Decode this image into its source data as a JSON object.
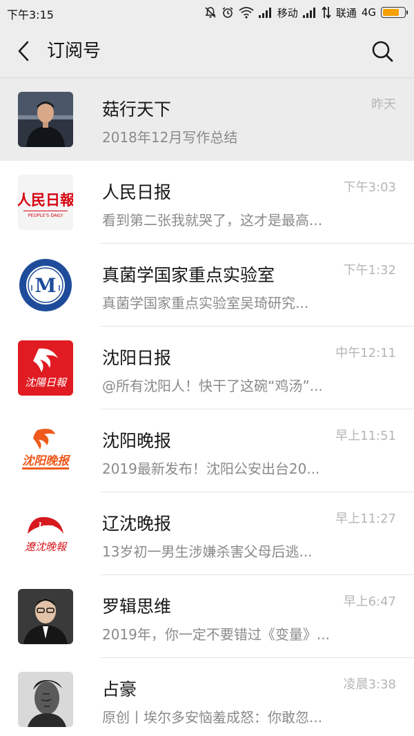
{
  "status_bar": {
    "time": "下午3:15",
    "carrier1": "移动",
    "carrier2": "联通",
    "network": "4G",
    "battery_level": 0.78,
    "battery_color": "#f5a000"
  },
  "header": {
    "title": "订阅号",
    "back_icon": "chevron-left-icon",
    "search_icon": "search-icon"
  },
  "rows": [
    {
      "name": "菇行天下",
      "preview": "2018年12月写作总结",
      "time": "昨天",
      "highlighted": true
    },
    {
      "name": "人民日报",
      "preview": "看到第二张我就哭了，这才是最高...",
      "time": "下午3:03",
      "logo_text": "PEOPLE'S DAILY"
    },
    {
      "name": "真菌学国家重点实验室",
      "preview": "真菌学国家重点实验室吴琦研究...",
      "time": "下午1:32",
      "logo_text": "M"
    },
    {
      "name": "沈阳日报",
      "preview": "@所有沈阳人！快干了这碗“鸡汤”...",
      "time": "中午12:11"
    },
    {
      "name": "沈阳晚报",
      "preview": "2019最新发布！沈阳公安出台20...",
      "time": "早上11:51",
      "logo_text": "沈阳晚报"
    },
    {
      "name": "辽沈晚报",
      "preview": "13岁初一男生涉嫌杀害父母后逃...",
      "time": "早上11:27"
    },
    {
      "name": "罗辑思维",
      "preview": "2019年，你一定不要错过《变量》...",
      "time": "早上6:47"
    },
    {
      "name": "占豪",
      "preview": "原创丨埃尔多安恼羞成怒：你敢忽...",
      "time": "凌晨3:38"
    }
  ],
  "colors": {
    "header_bg": "#ededed",
    "text_primary": "#161616",
    "text_secondary": "#8a8a8a",
    "timestamp": "#b5b5b5",
    "people_daily_red": "#d7000f",
    "lab_blue": "#1e4c9a",
    "shenyang_red": "#e01b22",
    "evening_orange": "#ef5a1c"
  }
}
